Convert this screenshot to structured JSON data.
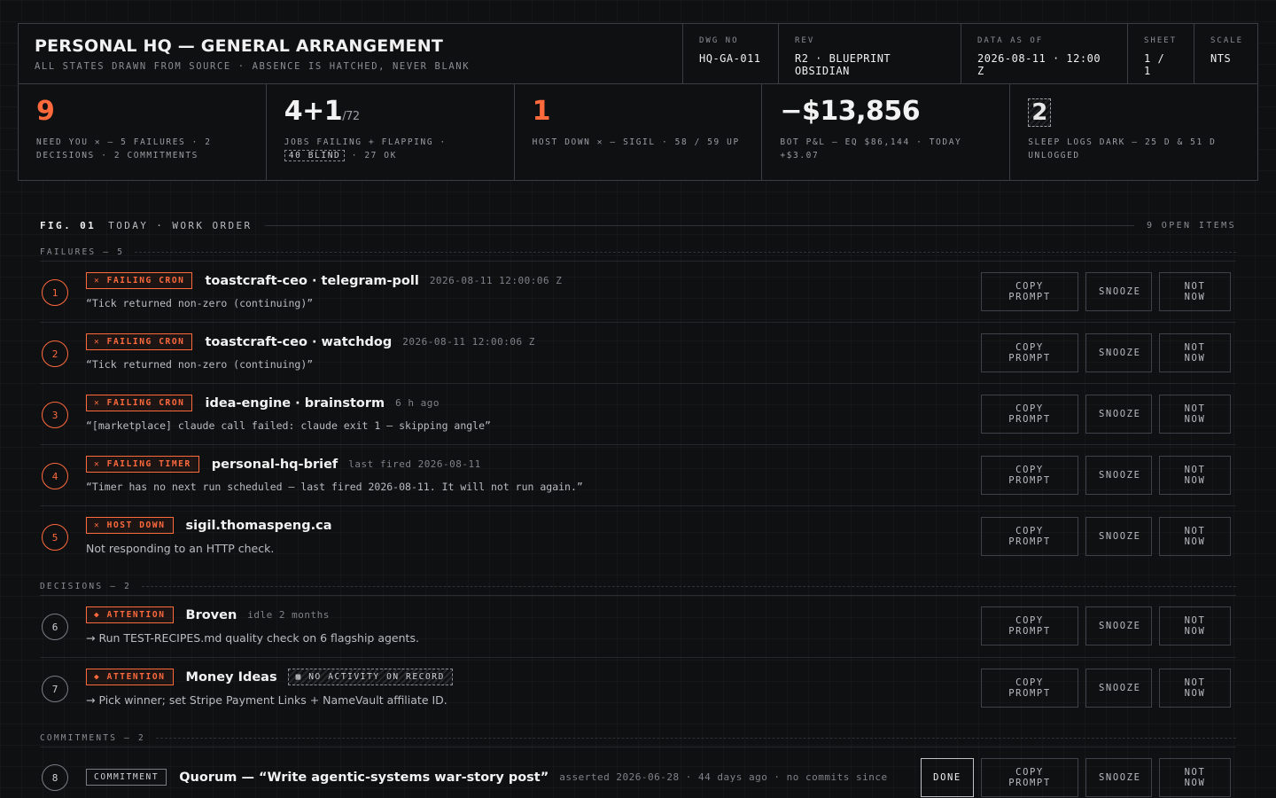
{
  "header": {
    "title": "PERSONAL HQ — GENERAL ARRANGEMENT",
    "subtitle": "ALL STATES DRAWN FROM SOURCE · ABSENCE IS HATCHED, NEVER BLANK",
    "cells": [
      {
        "label": "DWG NO",
        "value": "HQ-GA-011"
      },
      {
        "label": "REV",
        "value": "R2 · BLUEPRINT OBSIDIAN"
      },
      {
        "label": "DATA AS OF",
        "value": "2026-08-11 · 12:00 Z"
      },
      {
        "label": "SHEET",
        "value": "1 / 1"
      },
      {
        "label": "SCALE",
        "value": "NTS"
      }
    ]
  },
  "stats": {
    "need_you": {
      "big": "9",
      "desc": "NEED YOU ✕ — 5 FAILURES · 2 DECISIONS · 2 COMMITMENTS"
    },
    "jobs": {
      "big": "4+1",
      "small": "/72",
      "desc_a": "JOBS FAILING + FLAPPING ·",
      "blind": "40 BLIND",
      "desc_b": "· 27 OK"
    },
    "host": {
      "big": "1",
      "desc": "HOST DOWN ✕ — SIGIL · 58 / 59 UP"
    },
    "bot": {
      "big": "−$13,856",
      "desc": "BOT P&L — EQ $86,144 · TODAY +$3.07"
    },
    "sleep": {
      "big": "2",
      "desc": "SLEEP LOGS DARK — 25 D & 51 D UNLOGGED"
    }
  },
  "work_order": {
    "fig": "FIG. 01",
    "title": "TODAY · WORK ORDER",
    "open_items": "9 OPEN ITEMS",
    "sections": {
      "failures": {
        "label": "FAILURES",
        "count": "— 5"
      },
      "decisions": {
        "label": "DECISIONS",
        "count": "— 2"
      },
      "commitments": {
        "label": "COMMITMENTS",
        "count": "— 2"
      }
    },
    "buttons": {
      "copy": "COPY PROMPT",
      "snooze": "SNOOZE",
      "not_now": "NOT NOW",
      "done": "DONE"
    },
    "items": [
      {
        "num": "1",
        "tag": "✕ FAILING CRON",
        "name": "toastcraft-ceo · telegram-poll",
        "meta": "2026-08-11 12:00:06 Z",
        "detail": "“Tick returned non-zero (continuing)”"
      },
      {
        "num": "2",
        "tag": "✕ FAILING CRON",
        "name": "toastcraft-ceo · watchdog",
        "meta": "2026-08-11 12:00:06 Z",
        "detail": "“Tick returned non-zero (continuing)”"
      },
      {
        "num": "3",
        "tag": "✕ FAILING CRON",
        "name": "idea-engine · brainstorm",
        "meta": "6 h ago",
        "detail": "“[marketplace] claude call failed: claude exit 1 — skipping angle”"
      },
      {
        "num": "4",
        "tag": "✕ FAILING TIMER",
        "name": "personal-hq-brief",
        "meta": "last fired 2026-08-11",
        "detail": "“Timer has no next run scheduled — last fired 2026-08-11. It will not run again.”"
      },
      {
        "num": "5",
        "tag": "✕ HOST DOWN",
        "name": "sigil.thomaspeng.ca",
        "meta": "",
        "detail": "Not responding to an HTTP check."
      },
      {
        "num": "6",
        "tag": "◆ ATTENTION",
        "name": "Broven",
        "meta": "idle 2 months",
        "detail": "→ Run TEST-RECIPES.md quality check on 6 flagship agents."
      },
      {
        "num": "7",
        "tag": "◆ ATTENTION",
        "name": "Money Ideas",
        "badge": "▩ NO ACTIVITY ON RECORD",
        "detail": "→ Pick winner; set Stripe Payment Links + NameVault affiliate ID."
      },
      {
        "num": "8",
        "tag": "COMMITMENT",
        "name": "Quorum — “Write agentic-systems war-story post”",
        "meta": "asserted 2026-06-28 · 44 days ago · no commits since"
      }
    ]
  }
}
